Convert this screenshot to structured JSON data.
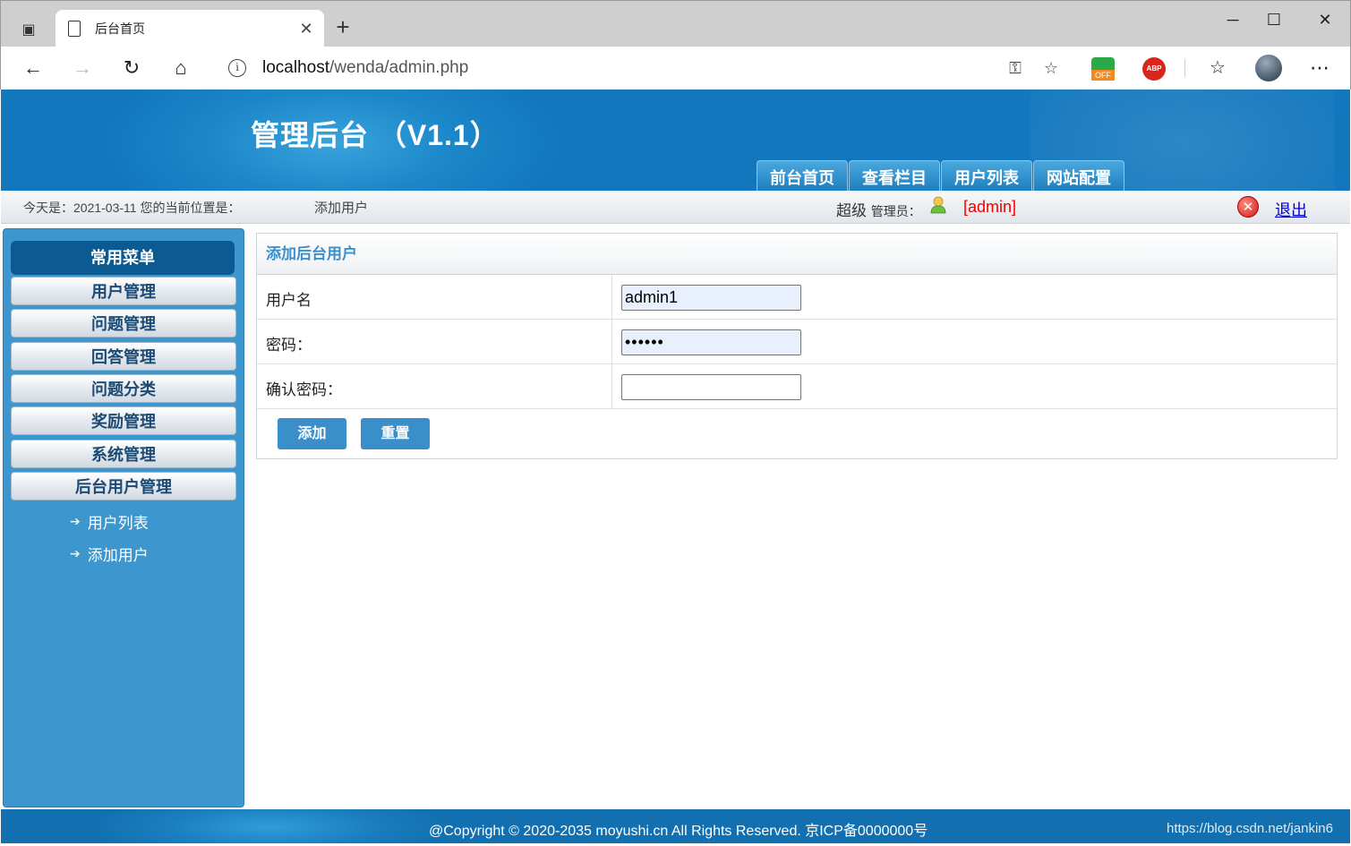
{
  "browser": {
    "tab_title": "后台首页",
    "url_host": "localhost",
    "url_path": "/wenda/admin.php",
    "ext_off_label": "OFF",
    "ext_abp_label": "ABP"
  },
  "header": {
    "title": "管理后台 （V1.1）",
    "nav": [
      "前台首页",
      "查看栏目",
      "用户列表",
      "网站配置"
    ]
  },
  "status": {
    "today": "今天是：2021-03-11 您的当前位置是：",
    "location": "添加用户",
    "role": "超级",
    "role_suffix": "管理员：",
    "username": "[admin]",
    "logout": "退出"
  },
  "sidebar": {
    "heading": "常用菜单",
    "items": [
      "用户管理",
      "问题管理",
      "回答管理",
      "问题分类",
      "奖励管理",
      "系统管理",
      "后台用户管理"
    ],
    "sub_items": [
      "用户列表",
      "添加用户"
    ]
  },
  "form": {
    "title": "添加后台用户",
    "username_label": "用户名",
    "username_value": "admin1",
    "password_label": "密码：",
    "password_value": "••••••",
    "confirm_label": "确认密码：",
    "confirm_value": "",
    "add_button": "添加",
    "reset_button": "重置"
  },
  "footer": {
    "copyright": "@Copyright © 2020-2035 moyushi.cn All Rights Reserved. 京ICP备0000000号",
    "watermark": "https://blog.csdn.net/jankin6"
  },
  "colors": {
    "header_blue": "#1a86c8",
    "sidebar_blue": "#3d96cd",
    "button_blue": "#3a8fca",
    "username_red": "#e00000"
  }
}
